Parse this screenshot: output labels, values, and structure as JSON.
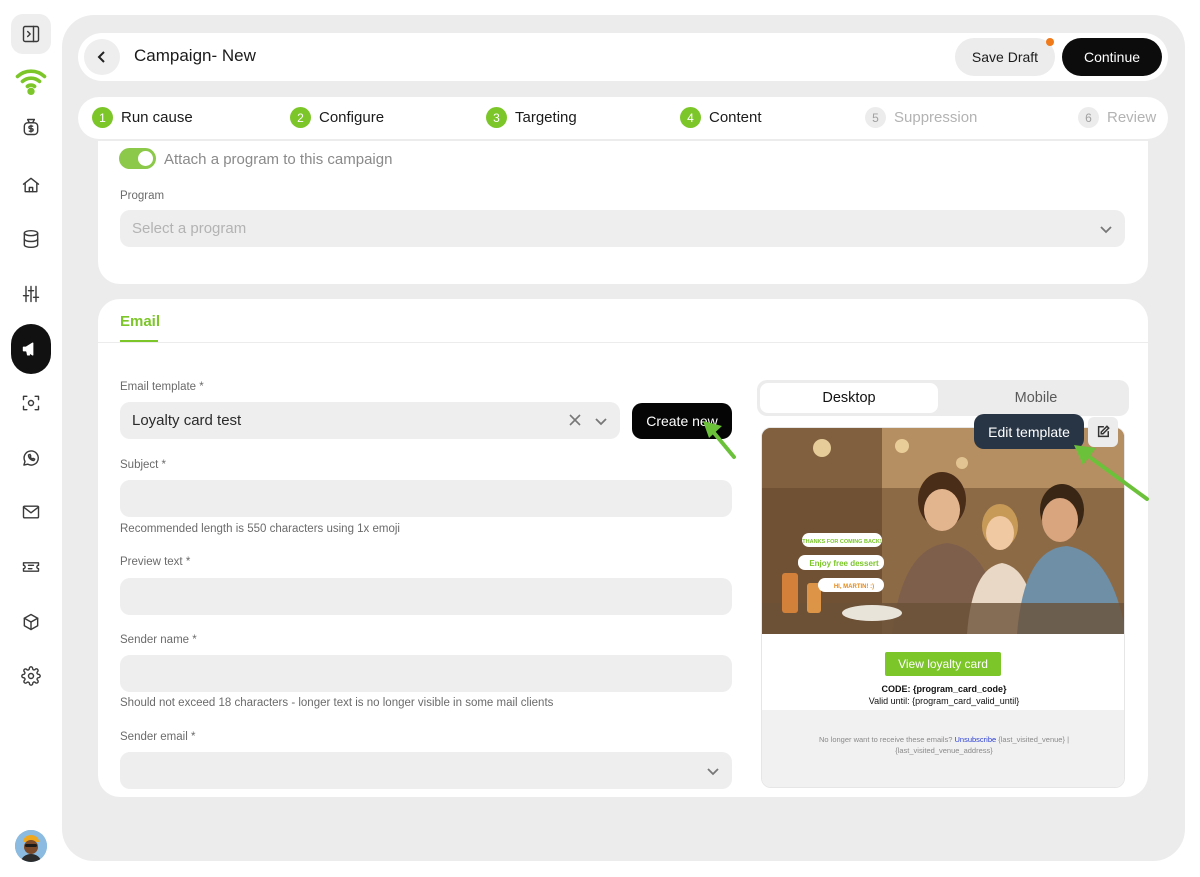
{
  "header": {
    "title": "Campaign- New",
    "save_draft": "Save Draft",
    "continue": "Continue"
  },
  "steps": [
    {
      "num": "1",
      "label": "Run cause",
      "state": "done"
    },
    {
      "num": "2",
      "label": "Configure",
      "state": "done"
    },
    {
      "num": "3",
      "label": "Targeting",
      "state": "done"
    },
    {
      "num": "4",
      "label": "Content",
      "state": "done"
    },
    {
      "num": "5",
      "label": "Suppression",
      "state": "pending"
    },
    {
      "num": "6",
      "label": "Review",
      "state": "pending"
    }
  ],
  "program_section": {
    "toggle_label": "Attach a program to this campaign",
    "toggle_on": true,
    "program_label": "Program",
    "program_placeholder": "Select a program"
  },
  "email_section": {
    "tab_label": "Email",
    "template_label": "Email template *",
    "template_value": "Loyalty card test",
    "create_new": "Create new",
    "subject_label": "Subject *",
    "subject_value": "",
    "subject_helper": "Recommended length is 550 characters using 1x emoji",
    "preview_label": "Preview text *",
    "preview_value": "",
    "sender_name_label": "Sender name *",
    "sender_name_value": "",
    "sender_name_helper": "Should not exceed 18 characters - longer text is no longer visible in some mail clients",
    "sender_email_label": "Sender email *",
    "sender_email_value": ""
  },
  "preview": {
    "device_options": [
      "Desktop",
      "Mobile"
    ],
    "selected_device": "Desktop",
    "edit_template": "Edit template",
    "image_tags": [
      "THANKS FOR COMING BACK!",
      "Enjoy free dessert",
      "HI, MARTIN! :)"
    ],
    "view_card": "View loyalty card",
    "code": "CODE: {program_card_code}",
    "valid_until": "Valid until: {program_card_valid_until}",
    "unsub_prefix": "No longer want to receive these emails?",
    "unsub_link": "Unsubscribe",
    "unsub_suffix": "{last_visited_venue} | {last_visited_venue_address}"
  },
  "colors": {
    "accent_green": "#7cc62a",
    "primary_black": "#0c0c0c",
    "notification_orange": "#f07a1a",
    "edit_template_bg": "#283545",
    "link_blue": "#2a3ed1"
  },
  "sidebar_icons": [
    "sidebar-toggle-icon",
    "wifi-logo-icon",
    "money-bag-icon",
    "home-icon",
    "database-icon",
    "sliders-icon",
    "megaphone-icon",
    "scan-face-icon",
    "whatsapp-icon",
    "mail-icon",
    "ticket-icon",
    "box-icon",
    "gear-icon"
  ]
}
